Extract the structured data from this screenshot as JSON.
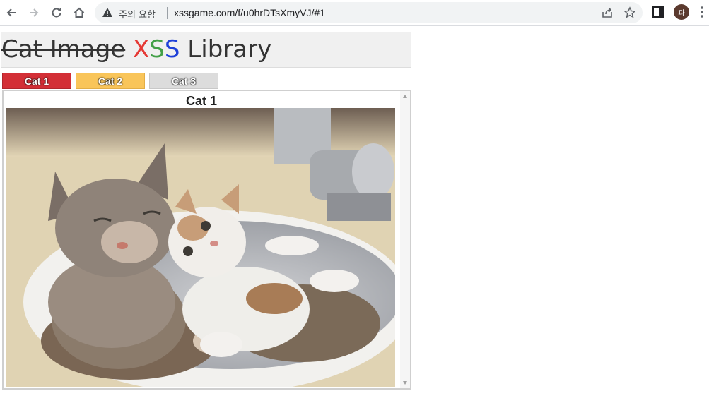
{
  "browser": {
    "security_label": "주의 요함",
    "url": "xssgame.com/f/u0hrDTsXmyVJ/#1",
    "avatar_letter": "파"
  },
  "page": {
    "title_strike": "Cat Image",
    "title_x": "X",
    "title_s1": "S",
    "title_s2": "S",
    "title_rest": " Library",
    "tabs": [
      {
        "label": "Cat 1",
        "color": "#d32f36"
      },
      {
        "label": "Cat 2",
        "color": "#f9c55a"
      },
      {
        "label": "Cat 3",
        "color": "#dcdcdc"
      }
    ],
    "content": {
      "heading": "Cat 1"
    }
  }
}
